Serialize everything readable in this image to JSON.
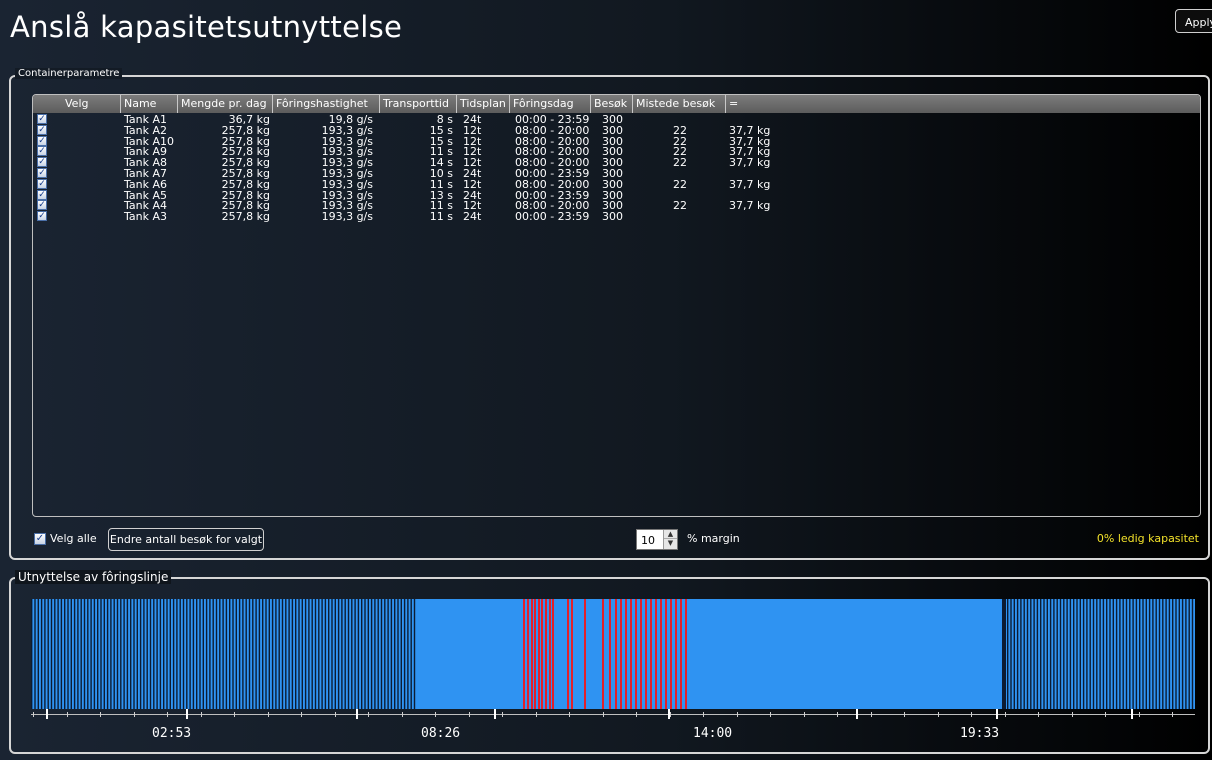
{
  "title": "Anslå kapasitetsutnyttelse",
  "apply_label": "Apply",
  "container_group": {
    "legend": "Containerparametre",
    "columns": [
      "Velg",
      "Name",
      "Mengde pr. dag",
      "Fôringshastighet",
      "Transporttid",
      "Tidsplan",
      "Fôringsdag",
      "Besøk",
      "Mistede besøk",
      "="
    ],
    "rows": [
      {
        "checked": true,
        "name": "Tank A1",
        "amount": "36,7 kg",
        "rate": "19,8 g/s",
        "transport": "8 s",
        "schedule": "24t",
        "feeding_day": "00:00 - 23:59",
        "visits": "300",
        "missed": "",
        "extra": ""
      },
      {
        "checked": true,
        "name": "Tank A2",
        "amount": "257,8 kg",
        "rate": "193,3 g/s",
        "transport": "15 s",
        "schedule": "12t",
        "feeding_day": "08:00 - 20:00",
        "visits": "300",
        "missed": "22",
        "extra": "37,7 kg"
      },
      {
        "checked": true,
        "name": "Tank A10",
        "amount": "257,8 kg",
        "rate": "193,3 g/s",
        "transport": "15 s",
        "schedule": "12t",
        "feeding_day": "08:00 - 20:00",
        "visits": "300",
        "missed": "22",
        "extra": "37,7 kg"
      },
      {
        "checked": true,
        "name": "Tank A9",
        "amount": "257,8 kg",
        "rate": "193,3 g/s",
        "transport": "11 s",
        "schedule": "12t",
        "feeding_day": "08:00 - 20:00",
        "visits": "300",
        "missed": "22",
        "extra": "37,7 kg"
      },
      {
        "checked": true,
        "name": "Tank A8",
        "amount": "257,8 kg",
        "rate": "193,3 g/s",
        "transport": "14 s",
        "schedule": "12t",
        "feeding_day": "08:00 - 20:00",
        "visits": "300",
        "missed": "22",
        "extra": "37,7 kg"
      },
      {
        "checked": true,
        "name": "Tank A7",
        "amount": "257,8 kg",
        "rate": "193,3 g/s",
        "transport": "10 s",
        "schedule": "24t",
        "feeding_day": "00:00 - 23:59",
        "visits": "300",
        "missed": "",
        "extra": ""
      },
      {
        "checked": true,
        "name": "Tank A6",
        "amount": "257,8 kg",
        "rate": "193,3 g/s",
        "transport": "11 s",
        "schedule": "12t",
        "feeding_day": "08:00 - 20:00",
        "visits": "300",
        "missed": "22",
        "extra": "37,7 kg"
      },
      {
        "checked": true,
        "name": "Tank A5",
        "amount": "257,8 kg",
        "rate": "193,3 g/s",
        "transport": "13 s",
        "schedule": "24t",
        "feeding_day": "00:00 - 23:59",
        "visits": "300",
        "missed": "",
        "extra": ""
      },
      {
        "checked": true,
        "name": "Tank A4",
        "amount": "257,8 kg",
        "rate": "193,3 g/s",
        "transport": "11 s",
        "schedule": "12t",
        "feeding_day": "08:00 - 20:00",
        "visits": "300",
        "missed": "22",
        "extra": "37,7 kg"
      },
      {
        "checked": true,
        "name": "Tank A3",
        "amount": "257,8 kg",
        "rate": "193,3 g/s",
        "transport": "11 s",
        "schedule": "24t",
        "feeding_day": "00:00 - 23:59",
        "visits": "300",
        "missed": "",
        "extra": ""
      }
    ],
    "select_all_label": "Velg alle",
    "select_all_checked": true,
    "change_visits_button": "Endre antall besøk for valgt",
    "margin_value": "10",
    "margin_label": "% margin",
    "capacity_text": "0% ledig kapasitet",
    "capacity_color": "#f2e12a"
  },
  "utilization_group": {
    "legend": "Utnyttelse av fôringslinje",
    "tick_labels": [
      "02:53",
      "08:26",
      "14:00",
      "19:33"
    ],
    "bar_color": "#2f93f2",
    "missed_color": "#e3202a",
    "busy_color": "#0c1c33"
  }
}
